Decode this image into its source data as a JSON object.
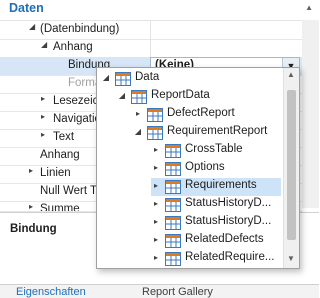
{
  "grid": {
    "category": "Daten",
    "rows": [
      {
        "label": "(Datenbindung)",
        "toggle": "◢",
        "value": ""
      },
      {
        "label": "Anhang",
        "toggle": "◢",
        "value": ""
      },
      {
        "label": "Bindung",
        "toggle": "",
        "value": "(Keine)"
      },
      {
        "label": "Format",
        "toggle": "",
        "value": ""
      },
      {
        "label": "Lesezeichen",
        "toggle": "▸",
        "value": ""
      },
      {
        "label": "Navigation",
        "toggle": "▸",
        "value": ""
      },
      {
        "label": "Text",
        "toggle": "▸",
        "value": ""
      },
      {
        "label": "Anhang",
        "toggle": "",
        "value": ""
      },
      {
        "label": "Linien",
        "toggle": "▸",
        "value": ""
      },
      {
        "label": "Null Wert Text",
        "toggle": "",
        "value": ""
      },
      {
        "label": "Summe",
        "toggle": "▸",
        "value": ""
      }
    ]
  },
  "description": {
    "title": "Bindung"
  },
  "bottom_tabs": {
    "properties": "Eigenschaften",
    "gallery": "Report Gallery"
  },
  "popup": {
    "items": [
      {
        "label": "Data",
        "arrow": "◢"
      },
      {
        "label": "ReportData",
        "arrow": "◢"
      },
      {
        "label": "DefectReport",
        "arrow": "▸"
      },
      {
        "label": "RequirementReport",
        "arrow": "◢"
      },
      {
        "label": "CrossTable",
        "arrow": "▸"
      },
      {
        "label": "Options",
        "arrow": "▸"
      },
      {
        "label": "Requirements",
        "arrow": "▸"
      },
      {
        "label": "StatusHistoryD...",
        "arrow": "▸"
      },
      {
        "label": "StatusHistoryD...",
        "arrow": "▸"
      },
      {
        "label": "RelatedDefects",
        "arrow": "▸"
      },
      {
        "label": "RelatedRequire...",
        "arrow": "▸"
      }
    ]
  },
  "colors": {
    "accent": "#1f6fb7",
    "selection": "#cde3f7",
    "table_icon_header": "#e07b1d",
    "table_icon_cell": "#3c78c2"
  },
  "icons": {
    "table": "table-icon",
    "expanded": "triangle-down-right-icon",
    "collapsed": "triangle-right-icon"
  }
}
